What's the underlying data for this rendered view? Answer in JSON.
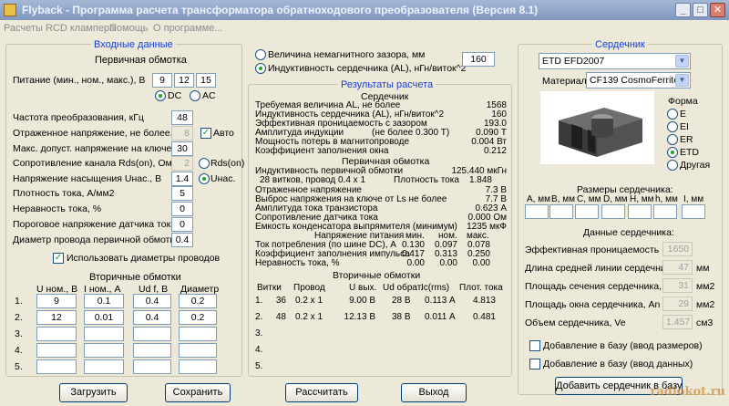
{
  "window": {
    "title": "Flyback - Программа расчета трансформатора обратноходового преобразователя (Версия 8.1)",
    "watermark": "radiokot.ru"
  },
  "menu": [
    "Расчеты RCD клампера",
    "Помощь",
    "О программе..."
  ],
  "input": {
    "title": "Входные данные",
    "primary_title": "Первичная обмотка",
    "supply_label": "Питание (мин., ном., макс.), В",
    "supply_min": "9",
    "supply_nom": "12",
    "supply_max": "15",
    "dc_label": "DC",
    "ac_label": "AC",
    "freq_label": "Частота преобразования, кГц",
    "freq_value": "48",
    "refl_label": "Отраженное напряжение, не более, В",
    "refl_value": "8",
    "auto_label": "Авто",
    "maxv_label": "Макс. допуст. напряжение на ключе, В",
    "maxv_value": "30",
    "rds_label": "Сопротивление канала Rds(on), Ом",
    "rds_value": "2",
    "rds_radio": "Rds(on)",
    "usat_label": "Напряжение насыщения Uнас., В",
    "usat_value": "1.4",
    "usat_radio": "Uнас.",
    "j_label": "Плотность тока, А/мм2",
    "j_value": "5",
    "uneven_label": "Неравность тока, %",
    "uneven_value": "0",
    "thr_label": "Пороговое напряжение датчика тока, В",
    "thr_value": "0",
    "diam_label": "Диаметр провода первичной обмотки",
    "diam_value": "0.4",
    "use_diam_label": "Использовать диаметры проводов",
    "secondary_title": "Вторичные обмотки",
    "sec_headers": [
      "U ном., В",
      "I ном., А",
      "Ud f, В",
      "Диаметр"
    ],
    "sec_rows": [
      {
        "n": "1.",
        "u": "9",
        "i": "0.1",
        "ud": "0.4",
        "d": "0.2"
      },
      {
        "n": "2.",
        "u": "12",
        "i": "0.01",
        "ud": "0.4",
        "d": "0.2"
      },
      {
        "n": "3.",
        "u": "",
        "i": "",
        "ud": "",
        "d": ""
      },
      {
        "n": "4.",
        "u": "",
        "i": "",
        "ud": "",
        "d": ""
      },
      {
        "n": "5.",
        "u": "",
        "i": "",
        "ud": "",
        "d": ""
      }
    ]
  },
  "gap": {
    "nonmag_label": "Величина немагнитного зазора, мм",
    "al_label": "Индуктивность сердечника (AL), нГн/виток^2",
    "value": "160"
  },
  "results": {
    "title": "Результаты расчета",
    "core_title": "Сердечник",
    "core_lines": [
      {
        "l": "Требуемая величина AL, не более",
        "v": "1568"
      },
      {
        "l": "Индуктивность сердечника (AL), нГн/виток^2",
        "v": "160"
      },
      {
        "l": "Эффективная проницаемость с зазором",
        "v": "193.0"
      },
      {
        "l": "Амплитуда индукции",
        "m": "(не более 0.300 Т)",
        "v": "0.090 Т"
      },
      {
        "l": "Мощность потерь в магнитопроводе",
        "v": "0.004 Вт"
      },
      {
        "l": "Коэффициент заполнения окна",
        "v": "0.212"
      }
    ],
    "primary_title": "Первичная обмотка",
    "ind_label": "Индуктивность первичной обмотки",
    "ind_value": "125.440 мкГн",
    "turns_label": "28 витков, провод 0.4 x 1",
    "pd_label": "Плотность тока",
    "pd_value": "1.848",
    "prim_lines": [
      {
        "l": "Отраженное напряжение",
        "v": "7.3 В"
      },
      {
        "l": "Выброс напряжения на ключе от Ls не более",
        "v": "7.7 В"
      },
      {
        "l": "Амплитуда тока транзистора",
        "v": "0.623 А"
      },
      {
        "l": "Сопротивление датчика тока",
        "v": "0.000 Ом"
      },
      {
        "l": "Емкость конденсатора выпрямителя (минимум)",
        "v": "1235 мкФ"
      }
    ],
    "supply_headers": [
      "Напряжение питания",
      "мин.",
      "ном.",
      "макс."
    ],
    "supply_rows": [
      {
        "l": "Ток потребления (по шине DC), А",
        "a": "0.130",
        "b": "0.097",
        "c": "0.078"
      },
      {
        "l": "Коэффициент заполнения импульса",
        "a": "0.417",
        "b": "0.313",
        "c": "0.250"
      },
      {
        "l": "Неравность тока, %",
        "a": "0.00",
        "b": "0.00",
        "c": "0.00"
      }
    ],
    "sec_title": "Вторичные обмотки",
    "sec_headers": [
      "Витки",
      "Провод",
      "U вых.",
      "Ud обрат.",
      "Ic(rms)",
      "Плот. тока"
    ],
    "sec_rows": [
      {
        "n": "1.",
        "t": "36",
        "w": "0.2 x 1",
        "u": "9.00 В",
        "ud": "28 В",
        "ic": "0.113 А",
        "j": "4.813"
      },
      {
        "n": "2.",
        "t": "48",
        "w": "0.2 x 1",
        "u": "12.13 В",
        "ud": "38 В",
        "ic": "0.011 А",
        "j": "0.481"
      },
      {
        "n": "3.",
        "t": "",
        "w": "",
        "u": "",
        "ud": "",
        "ic": "",
        "j": ""
      },
      {
        "n": "4.",
        "t": "",
        "w": "",
        "u": "",
        "ud": "",
        "ic": "",
        "j": ""
      },
      {
        "n": "5.",
        "t": "",
        "w": "",
        "u": "",
        "ud": "",
        "ic": "",
        "j": ""
      }
    ]
  },
  "core": {
    "title": "Сердечник",
    "type_value": "ETD EFD2007",
    "material_label": "Материал:",
    "material_value": "CF139 CosmoFerrites",
    "shape_title": "Форма",
    "shapes": [
      "E",
      "EI",
      "ER",
      "ETD",
      "Другая"
    ],
    "dims_title": "Размеры сердечника:",
    "dims_headers": [
      "A, мм",
      "B, мм",
      "C, мм",
      "D, мм",
      "H, мм",
      "h, мм",
      "I, мм"
    ],
    "data_title": "Данные сердечника:",
    "eff_perm_label": "Эффективная проницаемость",
    "eff_perm_value": "1650",
    "path_label": "Длина средней линии сердечника, le",
    "path_value": "47",
    "path_unit": "мм",
    "ae_label": "Площадь сечения сердечника, Ae",
    "ae_value": "31",
    "ae_unit": "мм2",
    "an_label": "Площадь окна сердечника, An",
    "an_value": "29",
    "an_unit": "мм2",
    "ve_label": "Объем сердечника, Ve",
    "ve_value": "1.457",
    "ve_unit": "см3",
    "add_dims_label": "Добавление в базу (ввод размеров)",
    "add_data_label": "Добавление в базу (ввод данных)",
    "add_button": "Добавить сердечник в базу"
  },
  "buttons": {
    "load": "Загрузить",
    "save": "Сохранить",
    "calc": "Рассчитать",
    "exit": "Выход"
  }
}
